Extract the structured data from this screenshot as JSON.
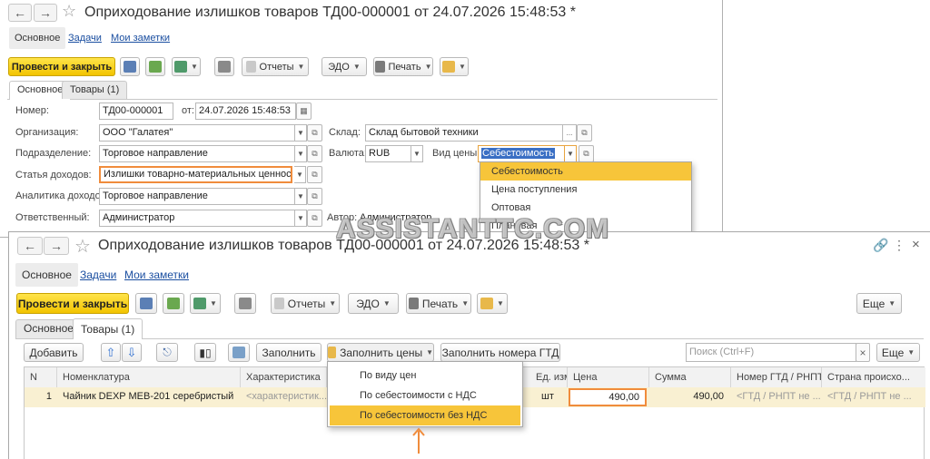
{
  "form1": {
    "title": "Оприходование излишков товаров ТД00-000001 от 24.07.2026 15:48:53 *",
    "panel_tabs": [
      "Основное",
      "Задачи",
      "Мои заметки"
    ],
    "toolbar": {
      "post_close": "Провести и закрыть",
      "reports": "Отчеты",
      "edo": "ЭДО",
      "print": "Печать"
    },
    "form_tabs": [
      "Основное",
      "Товары (1)"
    ],
    "fields": {
      "number_label": "Номер:",
      "number": "ТД00-000001",
      "date_label": "от:",
      "date": "24.07.2026 15:48:53",
      "org_label": "Организация:",
      "org": "ООО \"Галатея\"",
      "warehouse_label": "Склад:",
      "warehouse": "Склад бытовой техники",
      "division_label": "Подразделение:",
      "division": "Торговое направление",
      "currency_label": "Валюта:",
      "currency": "RUB",
      "price_type_label": "Вид цены:",
      "price_type": "Себестоимость",
      "income_item_label": "Статья доходов:",
      "income_item": "Излишки товарно-материальных ценностей",
      "income_analytics_label": "Аналитика доходов:",
      "income_analytics": "Торговое направление",
      "responsible_label": "Ответственный:",
      "responsible": "Администратор",
      "author_label": "Автор:",
      "author": "Администратор"
    },
    "price_type_options": [
      "Себестоимость",
      "Цена поступления",
      "Оптовая",
      "Плановая"
    ],
    "price_type_selected": "Себестоимость"
  },
  "form2": {
    "title": "Оприходование излишков товаров ТД00-000001 от 24.07.2026 15:48:53 *",
    "panel_tabs": [
      "Основное",
      "Задачи",
      "Мои заметки"
    ],
    "toolbar": {
      "post_close": "Провести и закрыть",
      "reports": "Отчеты",
      "edo": "ЭДО",
      "print": "Печать",
      "more": "Еще"
    },
    "form_tabs": [
      "Основное",
      "Товары (1)"
    ],
    "table_toolbar": {
      "add": "Добавить",
      "fill": "Заполнить",
      "fill_prices": "Заполнить цены",
      "fill_gtd": "Заполнить номера ГТД",
      "search_placeholder": "Поиск (Ctrl+F)",
      "more": "Еще"
    },
    "fill_prices_options": [
      "По виду цен",
      "По себестоимости с НДС",
      "По себестоимости без НДС"
    ],
    "fill_prices_selected": "По себестоимости без НДС",
    "columns": [
      "N",
      "Номенклатура",
      "Характеристика",
      "Ед. изм.",
      "Цена",
      "Сумма",
      "Номер ГТД / РНПТ",
      "Страна происхо..."
    ],
    "rows": [
      {
        "n": "1",
        "item": "Чайник DEXP MEB-201 серебристый",
        "characteristic": "<характеристик...",
        "unit": "шт",
        "price": "490,00",
        "sum": "490,00",
        "gtd": "<ГТД / РНПТ не ...",
        "country": "<ГТД / РНПТ не ..."
      }
    ]
  },
  "watermark": "ASSISTANTTC.COM",
  "colors": {
    "accent": "#f2c400",
    "highlight": "#f7c53a",
    "arrow": "#f08c3c",
    "link": "#1a4ea0"
  }
}
